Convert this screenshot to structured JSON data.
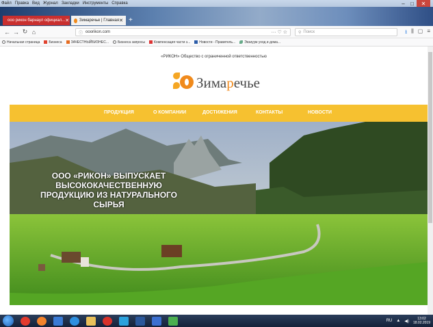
{
  "browser": {
    "menu": [
      "Файл",
      "Правка",
      "Вид",
      "Журнал",
      "Закладки",
      "Инструменты",
      "Справка"
    ],
    "tabs": [
      {
        "label": "ооо рикон барнаул официал..."
      },
      {
        "label": "Зимаречье | Главная"
      }
    ],
    "new_tab": "+",
    "url": "ooorikon.com",
    "search_placeholder": "Поиск",
    "bookmarks": [
      "Начальная страница",
      "Бизнеса",
      "ЗАЧЕСТНЫЙБИЗНЕС...",
      "Бизнеса запросы",
      "Компенсация части з...",
      "Новости - Правитель...",
      "Экзиуум уход и дома..."
    ]
  },
  "site": {
    "company_line": "«РИКОН» Общество с ограниченной ответственностью",
    "logo_text_prefix": "Зима",
    "logo_text_accent": "р",
    "logo_text_suffix": "ечье",
    "nav": [
      "ПРОДУКЦИЯ",
      "О КОМПАНИИ",
      "ДОСТИЖЕНИЯ",
      "КОНТАКТЫ",
      "НОВОСТИ"
    ],
    "hero": {
      "line1": "ООО «РИКОН» ВЫПУСКАЕТ",
      "line2": "ВЫСОКОКАЧЕСТВЕННУЮ",
      "line3": "ПРОДУКЦИЮ ИЗ НАТУРАЛЬНОГО",
      "line4": "СЫРЬЯ"
    }
  },
  "taskbar": {
    "lang": "RU",
    "time": "13:02",
    "date": "18.02.2019"
  },
  "colors": {
    "nav_yellow": "#f6c130",
    "logo_orange": "#f08a1c",
    "tab_active_red": "#c92f2f"
  }
}
